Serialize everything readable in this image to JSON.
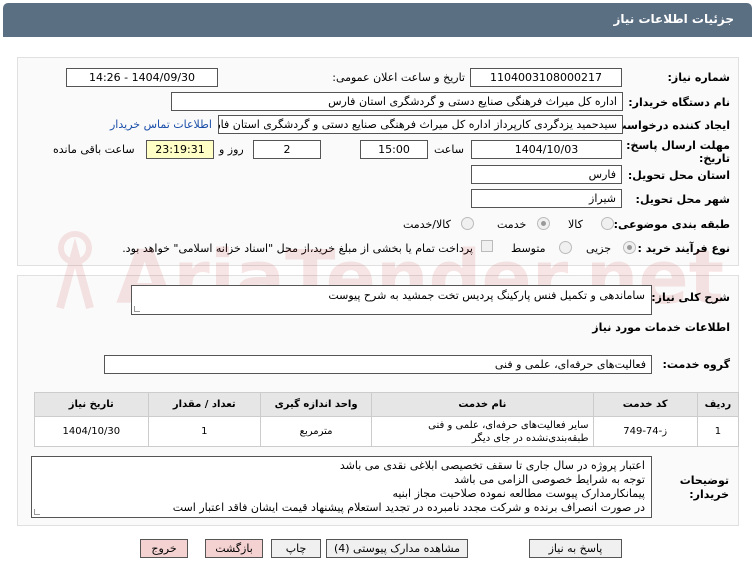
{
  "header": {
    "title": "جزئیات اطلاعات نیاز"
  },
  "fields": {
    "need_number_label": "شماره نیاز:",
    "need_number": "1104003108000217",
    "announce_label": "تاریخ و ساعت اعلان عمومی:",
    "announce_value": "1404/09/30 - 14:26",
    "buyer_label": "نام دستگاه خریدار:",
    "buyer_value": "اداره کل میراث فرهنگی  صنایع دستی و گردشگری استان فارس",
    "creator_label": "ایجاد کننده درخواست:",
    "creator_value": "سیدحمید یزدگردی کارپرداز اداره کل میراث فرهنگی  صنایع دستی و گردشگری استان فارس",
    "contact_link": "اطلاعات تماس خریدار",
    "deadline_label_line1": "مهلت ارسال پاسخ: تا",
    "deadline_label_line2": "تاریخ:",
    "deadline_date": "1404/10/03",
    "time_label": "ساعت",
    "deadline_time": "15:00",
    "days_value": "2",
    "days_label": "روز و",
    "remaining_time": "23:19:31",
    "remaining_label": "ساعت باقی مانده",
    "province_label": "استان محل تحویل:",
    "province_value": "فارس",
    "city_label": "شهر محل تحویل:",
    "city_value": "شیراز",
    "category_label": "طبقه بندی موضوعی:",
    "category_options": [
      "کالا",
      "خدمت",
      "کالا/خدمت"
    ],
    "category_selected": "خدمت",
    "process_label": "نوع فرآیند خرید :",
    "process_options": [
      "جزیی",
      "متوسط"
    ],
    "process_selected": "جزیی",
    "payment_note": "پرداخت تمام یا بخشی از مبلغ خرید،از محل \"اسناد خزانه اسلامی\" خواهد بود."
  },
  "description": {
    "label": "شرح کلی نیاز:",
    "value": "ساماندهی و تکمیل فنس پارکینگ پردیس تخت جمشید به شرح پیوست"
  },
  "services": {
    "section_title": "اطلاعات خدمات مورد نیاز",
    "group_label": "گروه خدمت:",
    "group_value": "فعالیت‌های حرفه‌ای، علمی و فنی"
  },
  "table": {
    "headers": [
      "ردیف",
      "کد خدمت",
      "نام خدمت",
      "واحد اندازه گیری",
      "تعداد / مقدار",
      "تاریخ نیاز"
    ],
    "rows": [
      [
        "1",
        "ز-74-749",
        "سایر فعالیت‌های حرفه‌ای، علمی و فنی طبقه‌بندی‌نشده در جای دیگر",
        "مترمربع",
        "1",
        "1404/10/30"
      ]
    ]
  },
  "buyer_notes": {
    "label_line1": "توضیحات",
    "label_line2": "خریدار:",
    "lines": [
      "اعتبار پروژه در سال جاری تا سقف تخصیصی ابلاغی نقدی می باشد",
      "توجه به شرایط خصوصی الزامی می باشد",
      "پیمانکارمدارک پیوست مطالعه نموده صلاحیت مجاز ابنیه",
      "در صورت انصراف برنده و شرکت مجدد نامبرده در تجدید استعلام  پیشنهاد قیمت ایشان فاقد اعتبار است"
    ]
  },
  "buttons": {
    "reply": "پاسخ به نیاز",
    "attachments": "مشاهده مدارک پیوستی (4)",
    "print": "چاپ",
    "back": "بازگشت",
    "exit": "خروج"
  },
  "watermark": {
    "text": "AriaTender.net"
  }
}
